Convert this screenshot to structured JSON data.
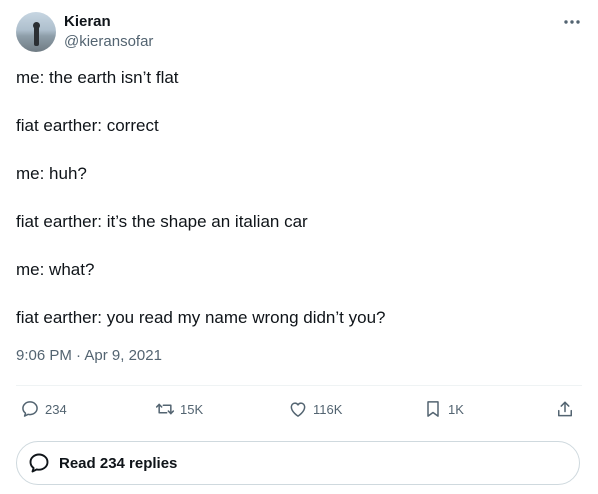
{
  "author": {
    "name": "Kieran",
    "handle": "@kieransofar"
  },
  "tweet": {
    "lines": [
      "me: the earth isn’t flat",
      "fiat earther: correct",
      "me: huh?",
      "fiat earther: it’s the shape an italian car",
      "me: what?",
      "fiat earther: you read my name wrong didn’t you?"
    ],
    "time": "9:06 PM",
    "separator": " · ",
    "date": "Apr 9, 2021"
  },
  "actions": {
    "replies": "234",
    "reposts": "15K",
    "likes": "116K",
    "bookmarks": "1K"
  },
  "read_replies_label": "Read 234 replies",
  "icons": {
    "reply": "speech-bubble-icon",
    "repost": "repost-icon",
    "like": "heart-icon",
    "bookmark": "bookmark-icon",
    "share": "share-icon",
    "more": "more-dots-icon"
  },
  "colors": {
    "text": "#0f1419",
    "secondary": "#536471",
    "border": "#cfd9de"
  }
}
